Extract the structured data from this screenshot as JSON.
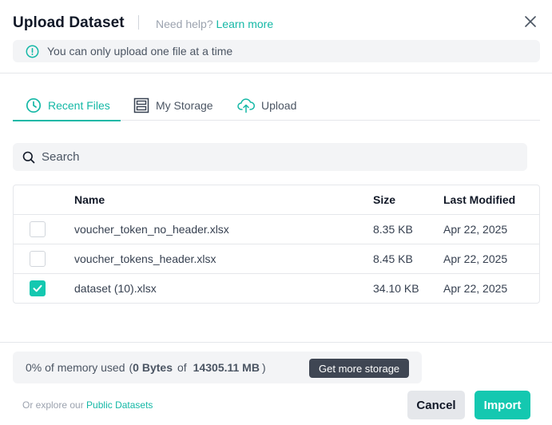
{
  "dialog": {
    "title": "Upload Dataset",
    "help_prefix": "Need help?",
    "help_link": "Learn more",
    "close_icon": "close-icon"
  },
  "notice": {
    "icon": "info-circle-icon",
    "text": "You can only upload one file at a time"
  },
  "tabs": [
    {
      "label": "Recent Files",
      "icon": "clock-icon",
      "active": true
    },
    {
      "label": "My Storage",
      "icon": "storage-icon",
      "active": false
    },
    {
      "label": "Upload",
      "icon": "cloud-upload-icon",
      "active": false
    }
  ],
  "search": {
    "placeholder": "Search",
    "value": ""
  },
  "table": {
    "columns": [
      "Name",
      "Size",
      "Last Modified"
    ],
    "rows": [
      {
        "name": "voucher_token_no_header.xlsx",
        "size": "8.35 KB",
        "modified": "Apr 22, 2025",
        "checked": false
      },
      {
        "name": "voucher_tokens_header.xlsx",
        "size": "8.45 KB",
        "modified": "Apr 22, 2025",
        "checked": false
      },
      {
        "name": "dataset (10).xlsx",
        "size": "34.10 KB",
        "modified": "Apr 22, 2025",
        "checked": true
      }
    ]
  },
  "memory": {
    "used_text": "0% of memory used",
    "used_value": "0 Bytes",
    "of_text": "of",
    "total_value": "14305.11 MB",
    "button_label": "Get more storage"
  },
  "footer": {
    "explore_prefix": "Or explore our",
    "explore_link": "Public Datasets",
    "cancel_label": "Cancel",
    "import_label": "Import"
  },
  "colors": {
    "accent": "#14b8a6",
    "checkbox_checked": "#14c8b0",
    "dark_button": "#3f4653"
  }
}
